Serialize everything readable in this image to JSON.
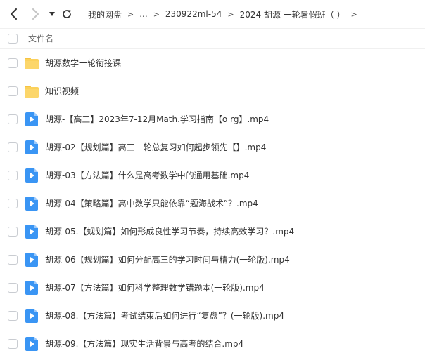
{
  "toolbar": {
    "back_icon": "chevron-left-icon",
    "forward_icon": "chevron-right-icon",
    "history_icon": "caret-down-icon",
    "refresh_icon": "refresh-icon"
  },
  "breadcrumb": {
    "items": [
      "我的网盘",
      "...",
      "230922ml-54",
      "2024 胡源 一轮暑假班（ ）"
    ],
    "separator": ">"
  },
  "header": {
    "name_label": "文件名"
  },
  "files": [
    {
      "type": "folder",
      "name": "胡源数学一轮衔接课"
    },
    {
      "type": "folder",
      "name": "知识视频"
    },
    {
      "type": "video",
      "name": "胡源-【高三】2023年7-12月Math.学习指南【o rg】.mp4"
    },
    {
      "type": "video",
      "name": "胡源-02【规划篇】高三一轮总复习如何起步领先【】.mp4"
    },
    {
      "type": "video",
      "name": "胡源-03【方法篇】什么是高考数学中的通用基础.mp4"
    },
    {
      "type": "video",
      "name": "胡源-04【策略篇】高中数学只能依靠“题海战术”？.mp4"
    },
    {
      "type": "video",
      "name": "胡源-05.【规划篇】如何形成良性学习节奏，持续高效学习？.mp4"
    },
    {
      "type": "video",
      "name": "胡源-06【规划篇】如何分配高三的学习时间与精力(一轮版).mp4"
    },
    {
      "type": "video",
      "name": "胡源-07【方法篇】如何科学整理数学错题本(一轮版).mp4"
    },
    {
      "type": "video",
      "name": "胡源-08.【方法篇】考试结束后如何进行“复盘”？(一轮版).mp4"
    },
    {
      "type": "video",
      "name": "胡源-09.【方法篇】现实生活背景与高考的结合.mp4"
    }
  ],
  "colors": {
    "folder": "#fbd15b",
    "video": "#3a95f4",
    "text": "#333333",
    "muted": "#666666"
  }
}
